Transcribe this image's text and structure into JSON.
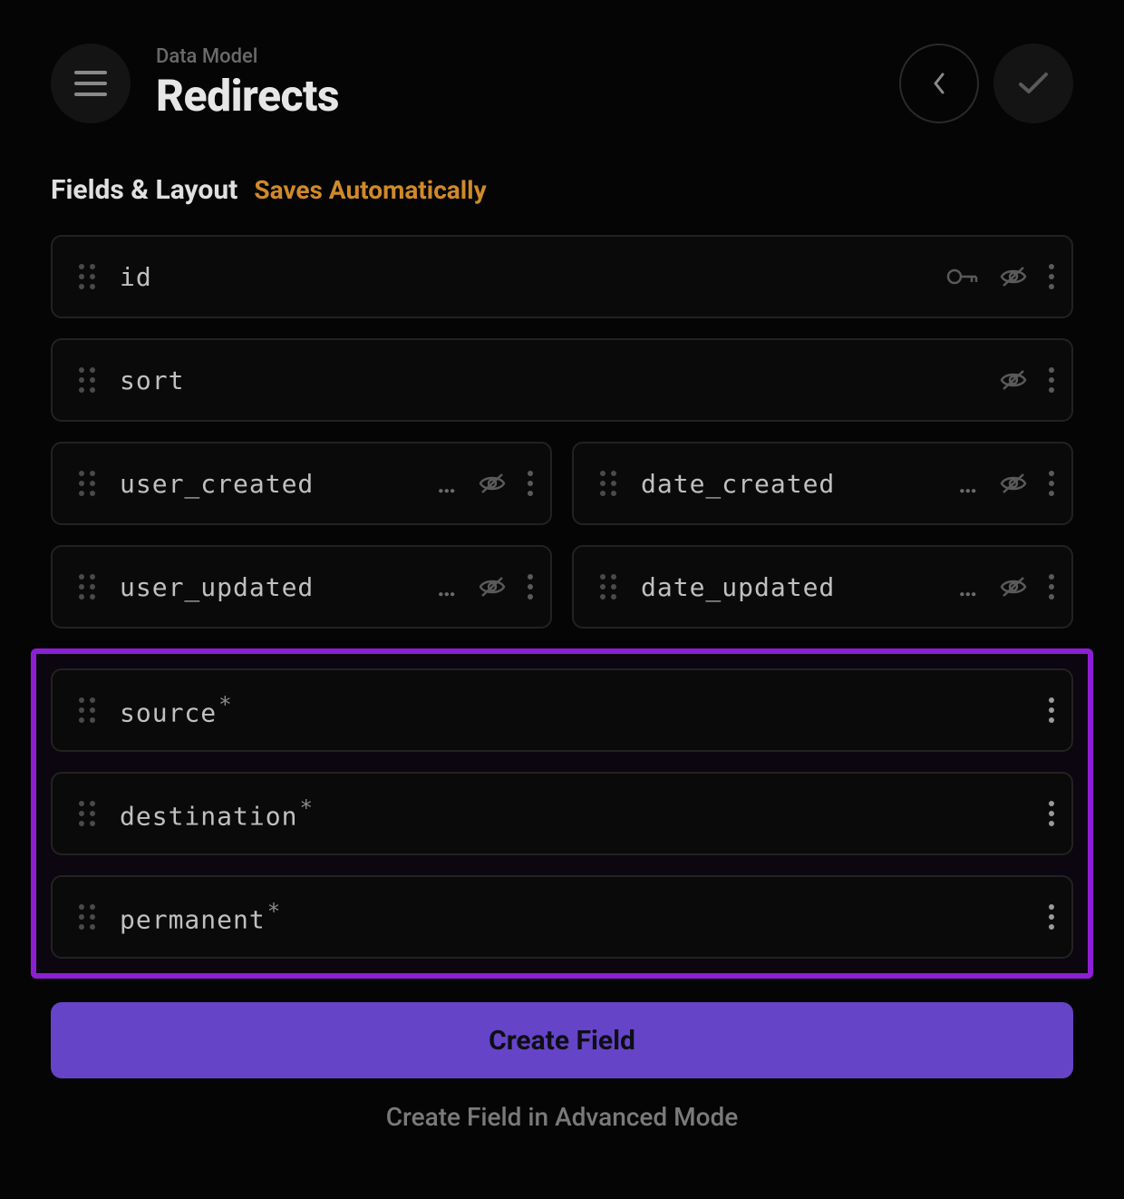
{
  "header": {
    "eyebrow": "Data Model",
    "title": "Redirects"
  },
  "section": {
    "heading": "Fields & Layout",
    "autosave": "Saves Automatically"
  },
  "fields": {
    "id": {
      "name": "id",
      "hasKey": true,
      "hidden": true,
      "required": false,
      "half": false
    },
    "sort": {
      "name": "sort",
      "hasKey": false,
      "hidden": true,
      "required": false,
      "half": false
    },
    "user_created": {
      "name": "user_created",
      "hasKey": false,
      "hidden": true,
      "required": false,
      "half": true,
      "truncated": true
    },
    "date_created": {
      "name": "date_created",
      "hasKey": false,
      "hidden": true,
      "required": false,
      "half": true,
      "truncated": true
    },
    "user_updated": {
      "name": "user_updated",
      "hasKey": false,
      "hidden": true,
      "required": false,
      "half": true,
      "truncated": true
    },
    "date_updated": {
      "name": "date_updated",
      "hasKey": false,
      "hidden": true,
      "required": false,
      "half": true,
      "truncated": true
    },
    "source": {
      "name": "source",
      "hasKey": false,
      "hidden": false,
      "required": true,
      "half": false
    },
    "destination": {
      "name": "destination",
      "hasKey": false,
      "hidden": false,
      "required": true,
      "half": false
    },
    "permanent": {
      "name": "permanent",
      "hasKey": false,
      "hidden": false,
      "required": true,
      "half": false
    }
  },
  "actions": {
    "create_label": "Create Field",
    "advanced_label": "Create Field in Advanced Mode"
  },
  "icons": {
    "menu": "menu-icon",
    "back": "chevron-left-icon",
    "confirm": "check-icon",
    "drag": "drag-handle-icon",
    "key": "key-icon",
    "hidden": "eye-off-icon",
    "more": "more-vert-icon"
  },
  "colors": {
    "accent": "#6644c7",
    "highlight": "#8c1fd4",
    "autosave": "#d08a2a"
  }
}
